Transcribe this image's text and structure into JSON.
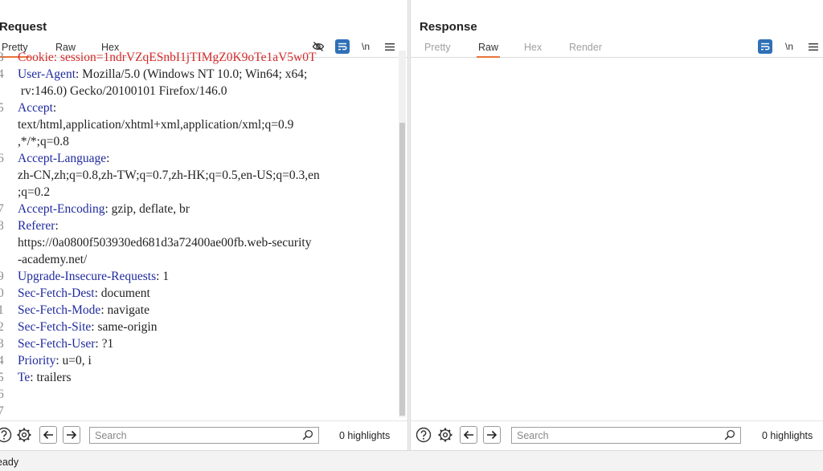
{
  "request": {
    "title": "Request",
    "tabs": [
      {
        "label": "Pretty",
        "active": true
      },
      {
        "label": "Raw",
        "active": false
      },
      {
        "label": "Hex",
        "active": false
      }
    ],
    "toolbar": {
      "newline_label": "\\n"
    },
    "lines": [
      {
        "num": "3",
        "key": "Cookie: session=1ndrVZqESnbI1jTIMgZ0K9oTe1aV5w0T",
        "value": ""
      },
      {
        "num": "4",
        "key": "User-Agent",
        "value": ": Mozilla/5.0 (Windows NT 10.0; Win64; x64;"
      },
      {
        "num": "",
        "key": "",
        "value": " rv:146.0) Gecko/20100101 Firefox/146.0"
      },
      {
        "num": "5",
        "key": "Accept",
        "value": ":"
      },
      {
        "num": "",
        "key": "",
        "value": "text/html,application/xhtml+xml,application/xml;q=0.9"
      },
      {
        "num": "",
        "key": "",
        "value": ",*/*;q=0.8"
      },
      {
        "num": "6",
        "key": "Accept-Language",
        "value": ":"
      },
      {
        "num": "",
        "key": "",
        "value": "zh-CN,zh;q=0.8,zh-TW;q=0.7,zh-HK;q=0.5,en-US;q=0.3,en"
      },
      {
        "num": "",
        "key": "",
        "value": ";q=0.2"
      },
      {
        "num": "7",
        "key": "Accept-Encoding",
        "value": ": gzip, deflate, br"
      },
      {
        "num": "8",
        "key": "Referer",
        "value": ":"
      },
      {
        "num": "",
        "key": "",
        "value": "https://0a0800f503930ed681d3a72400ae00fb.web-security"
      },
      {
        "num": "",
        "key": "",
        "value": "-academy.net/"
      },
      {
        "num": "9",
        "key": "Upgrade-Insecure-Requests",
        "value": ": 1"
      },
      {
        "num": "0",
        "key": "Sec-Fetch-Dest",
        "value": ": document"
      },
      {
        "num": "1",
        "key": "Sec-Fetch-Mode",
        "value": ": navigate"
      },
      {
        "num": "2",
        "key": "Sec-Fetch-Site",
        "value": ": same-origin"
      },
      {
        "num": "3",
        "key": "Sec-Fetch-User",
        "value": ": ?1"
      },
      {
        "num": "4",
        "key": "Priority",
        "value": ": u=0, i"
      },
      {
        "num": "5",
        "key": "Te",
        "value": ": trailers"
      },
      {
        "num": "6",
        "key": "",
        "value": ""
      },
      {
        "num": "7",
        "key": "",
        "value": ""
      }
    ],
    "footer": {
      "search_placeholder": "Search",
      "highlights": "0 highlights"
    }
  },
  "response": {
    "title": "Response",
    "tabs": [
      {
        "label": "Pretty",
        "active": false
      },
      {
        "label": "Raw",
        "active": true
      },
      {
        "label": "Hex",
        "active": false
      },
      {
        "label": "Render",
        "active": false
      }
    ],
    "toolbar": {
      "newline_label": "\\n"
    },
    "footer": {
      "search_placeholder": "Search",
      "highlights": "0 highlights"
    }
  },
  "status": {
    "text": "eady"
  },
  "icons": {
    "hide": "eye-slash-icon",
    "wrap": "wrap-lines-icon",
    "menu": "hamburger-menu-icon",
    "help": "question-circle-icon",
    "settings": "gear-icon",
    "back": "arrow-left-icon",
    "forward": "arrow-right-icon",
    "search": "magnifier-icon"
  },
  "colors": {
    "accent": "#2f70b7",
    "tab_underline": "#e8743b",
    "header_key": "#1f2a9e",
    "cookie": "#d42a2a"
  }
}
